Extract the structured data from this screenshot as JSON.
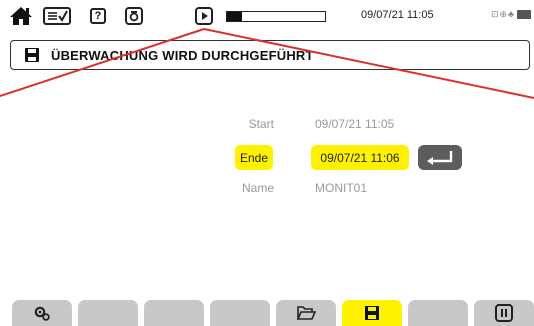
{
  "status_bar": {
    "icons": [
      "home-icon",
      "checklist-icon",
      "help-icon",
      "camera-icon",
      "play-icon"
    ],
    "help_glyph": "?",
    "progress": 0.15,
    "datetime": "09/07/21 11:05",
    "indicators": "⊡⊕♣"
  },
  "title_panel": {
    "icon": "floppy-disk-icon",
    "title": "ÜBERWACHUNG WIRD DURCHGEFÜHRT"
  },
  "form": {
    "start_label": "Start",
    "start_value": "09/07/21 11:05",
    "end_label": "Ende",
    "end_value": "09/07/21 11:06",
    "name_label": "Name",
    "name_value": "MONIT01"
  },
  "bottom_tabs": {
    "items": [
      "settings-icon",
      "",
      "",
      "",
      "open-folder-icon",
      "floppy-disk-icon",
      "",
      "pause-icon"
    ],
    "active": "floppy-disk-icon"
  },
  "colors": {
    "highlight": "#fff200",
    "tab": "#c8c8c8",
    "annotation_line": "#d9322e"
  }
}
